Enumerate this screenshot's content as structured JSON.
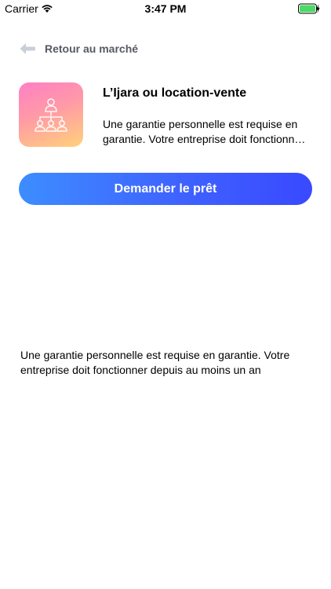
{
  "status_bar": {
    "carrier": "Carrier",
    "time": "3:47 PM",
    "battery_color": "#4cd964",
    "wifi_icon": "wifi-icon",
    "battery_icon": "battery-charging-icon"
  },
  "nav": {
    "back_label": "Retour au marché",
    "back_icon": "arrow-left-icon"
  },
  "product": {
    "icon": "network-users-icon",
    "title": "L’Ijara ou location-vente",
    "short_description": "Une garantie personnelle est requise en garantie. Votre entreprise doit fonctionner depuis au moins un an"
  },
  "cta": {
    "label": "Demander le prêt",
    "gradient_start": "#3d8dff",
    "gradient_end": "#3949ff"
  },
  "details": {
    "text": "Une garantie personnelle est requise en garantie. Votre entreprise doit fonctionner depuis au moins un an"
  }
}
